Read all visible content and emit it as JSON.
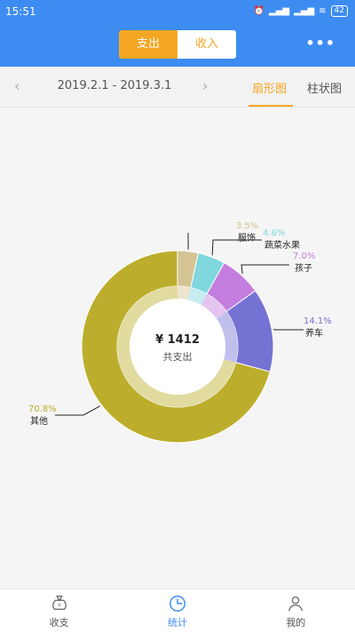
{
  "status": {
    "time": "15:51",
    "battery": "42"
  },
  "header": {
    "tabs": [
      {
        "label": "支出",
        "active": true
      },
      {
        "label": "收入",
        "active": false
      }
    ],
    "more_label": "•••"
  },
  "datebar": {
    "prev": "‹",
    "next": "›",
    "range": "2019.2.1 - 2019.3.1",
    "views": [
      {
        "label": "扇形图",
        "active": true
      },
      {
        "label": "柱状图",
        "active": false
      }
    ]
  },
  "chart_data": {
    "type": "pie",
    "center": {
      "amount": "¥ 1412",
      "label": "共支出"
    },
    "slices": [
      {
        "name": "其他",
        "percent": "70.8%",
        "value": 70.8,
        "color": "#bcae2c"
      },
      {
        "name": "服饰",
        "percent": "3.5%",
        "value": 3.5,
        "color": "#d6c393"
      },
      {
        "name": "蔬菜水果",
        "percent": "4.6%",
        "value": 4.6,
        "color": "#7fd6dd"
      },
      {
        "name": "孩子",
        "percent": "7.0%",
        "value": 7.0,
        "color": "#c47ee0"
      },
      {
        "name": "养车",
        "percent": "14.1%",
        "value": 14.1,
        "color": "#7572d4"
      }
    ]
  },
  "tabbar": {
    "items": [
      {
        "label": "收支",
        "active": false
      },
      {
        "label": "统计",
        "active": true
      },
      {
        "label": "我的",
        "active": false
      }
    ]
  },
  "colors": {
    "primary": "#3d8cf2",
    "accent": "#f5a623"
  }
}
